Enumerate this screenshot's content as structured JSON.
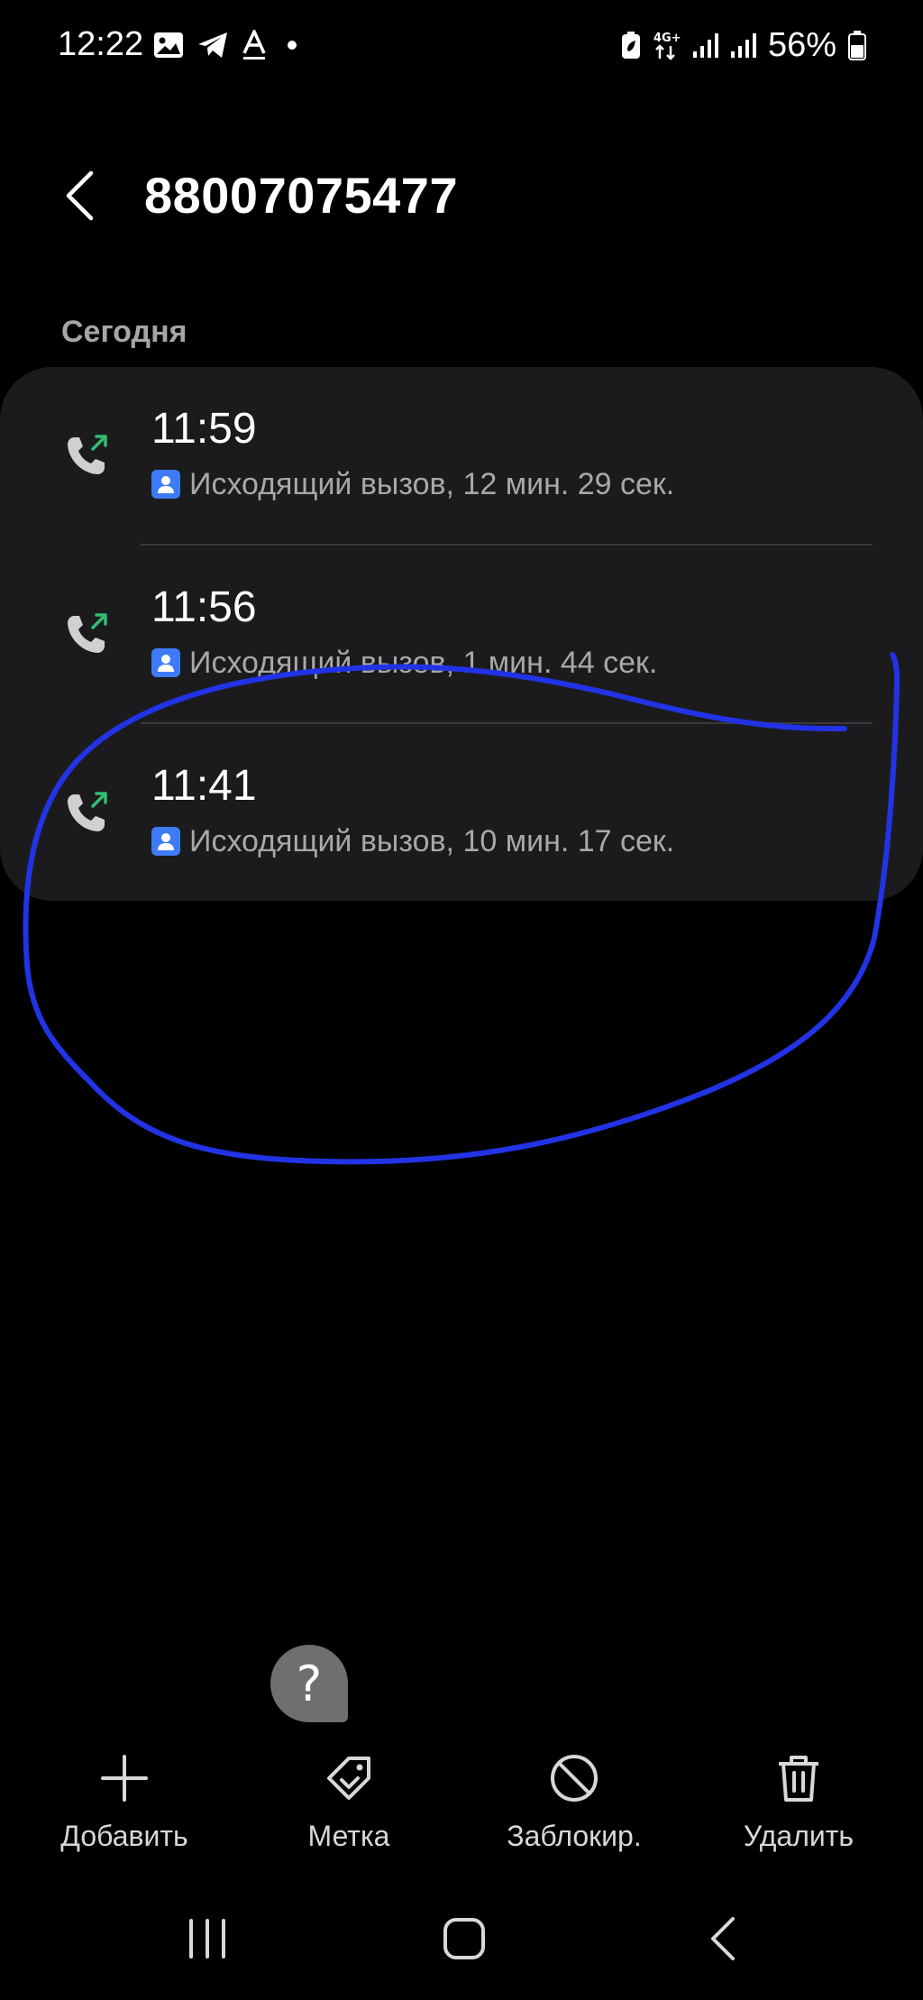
{
  "status_bar": {
    "time": "12:22",
    "network": "4G+",
    "battery": "56%"
  },
  "header": {
    "title": "88007075477",
    "back_icon": "chevron-left-icon"
  },
  "section": {
    "label": "Сегодня"
  },
  "calls": [
    {
      "time": "11:59",
      "description": "Исходящий вызов, 12 мин. 29 сек.",
      "icon": "outgoing-call-icon"
    },
    {
      "time": "11:56",
      "description": "Исходящий вызов, 1 мин. 44 сек.",
      "icon": "outgoing-call-icon"
    },
    {
      "time": "11:41",
      "description": "Исходящий вызов, 10 мин. 17 сек.",
      "icon": "outgoing-call-icon"
    }
  ],
  "help": {
    "label": "?"
  },
  "actions": {
    "add": "Добавить",
    "tag": "Метка",
    "block": "Заблокир.",
    "delete": "Удалить"
  },
  "colors": {
    "background": "#000000",
    "card": "#1b1b1d",
    "accent_green": "#2fbf71",
    "contact_blue": "#3d7cf6",
    "annotation_blue": "#2233e6"
  }
}
